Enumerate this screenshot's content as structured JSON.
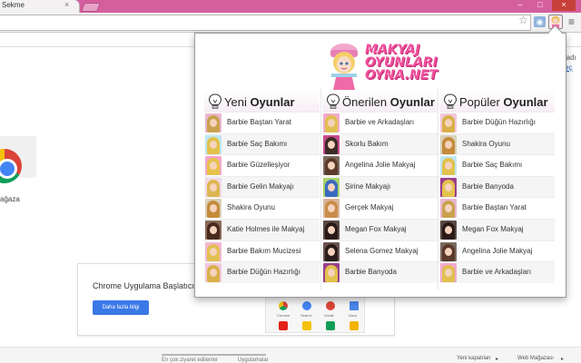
{
  "browser": {
    "tab_title": "Sekme",
    "tab_close": "×",
    "win_minimize": "–",
    "win_maximize": "□",
    "win_close": "×",
    "star_icon": "☆",
    "menu_icon": "≡",
    "camera_icon": "camera-icon"
  },
  "background_page": {
    "store_label": "ağaza",
    "right_text_1": "ınadı",
    "right_text_2": "eç",
    "launcher_title": "Chrome Uygulama Başlatıcıy",
    "launcher_button": "Daha fazla bilgi",
    "mini_apps": [
      "Chrome",
      "Search",
      "Gmail",
      "Docs"
    ],
    "bottom_tabs": [
      "En çok ziyaret edilenler",
      "Uygulamalar"
    ],
    "bottom_right": [
      "Yeni kapatılan",
      "Web Mağazası"
    ],
    "bottom_right_arrow": "▸"
  },
  "popup": {
    "logo_lines": [
      "MAKYAJ",
      "OYUNLARI",
      "OYNA.NET"
    ],
    "columns": [
      {
        "title_light": "Yeni ",
        "title_bold": "Oyunlar",
        "items": [
          {
            "label": "Barbie Baştan Yarat",
            "hair": "#c9a24e",
            "bg": "#e9b6cf"
          },
          {
            "label": "Barbie Saç Bakımı",
            "hair": "#e2c14b",
            "bg": "#bfe6f2"
          },
          {
            "label": "Barbie Güzelleşiyor",
            "hair": "#e6c24a",
            "bg": "#f4a6c9"
          },
          {
            "label": "Barbie Gelin Makyajı",
            "hair": "#dcb651",
            "bg": "#f0d8e6"
          },
          {
            "label": "Shakira Oyunu",
            "hair": "#c58b3b",
            "bg": "#d9d0b8"
          },
          {
            "label": "Katie Holmes ile Makyaj",
            "hair": "#4a2a1e",
            "bg": "#8a6a58"
          },
          {
            "label": "Barbie Bakım Mucizesi",
            "hair": "#e1c052",
            "bg": "#f2b7d3"
          },
          {
            "label": "Barbie Düğün Hazırlığı",
            "hair": "#d9b049",
            "bg": "#f3c7dd"
          }
        ]
      },
      {
        "title_light": "Önerilen ",
        "title_bold": "Oyunlar",
        "items": [
          {
            "label": "Barbie ve Arkadaşları",
            "hair": "#e0c04f",
            "bg": "#f2a9cd"
          },
          {
            "label": "Skorlu Bakım",
            "hair": "#3b2a25",
            "bg": "#c84a8e"
          },
          {
            "label": "Angelina Jolie Makyaj",
            "hair": "#5a3a2a",
            "bg": "#7a6a60"
          },
          {
            "label": "Şirine Makyajı",
            "hair": "#3a6ac0",
            "bg": "#a9d36a"
          },
          {
            "label": "Gerçek Makyaj",
            "hair": "#c98d4a",
            "bg": "#dbb49a"
          },
          {
            "label": "Megan Fox Makyaj",
            "hair": "#2a1a18",
            "bg": "#5a4a44"
          },
          {
            "label": "Selena Gomez Makyaj",
            "hair": "#2a1c1a",
            "bg": "#6a5450"
          },
          {
            "label": "Barbie Banyoda",
            "hair": "#e3c24c",
            "bg": "#9a3f8c"
          }
        ]
      },
      {
        "title_light": "Popüler ",
        "title_bold": "Oyunlar",
        "items": [
          {
            "label": "Barbie Düğün Hazırlığı",
            "hair": "#d9b049",
            "bg": "#f3c7dd"
          },
          {
            "label": "Shakira Oyunu",
            "hair": "#c58b3b",
            "bg": "#d9d0b8"
          },
          {
            "label": "Barbie Saç Bakımı",
            "hair": "#e2c14b",
            "bg": "#bfe6f2"
          },
          {
            "label": "Barbie Banyoda",
            "hair": "#e3c24c",
            "bg": "#9a3f8c"
          },
          {
            "label": "Barbie Baştan Yarat",
            "hair": "#c9a24e",
            "bg": "#e9b6cf"
          },
          {
            "label": "Megan Fox Makyaj",
            "hair": "#2a1a18",
            "bg": "#5a4a44"
          },
          {
            "label": "Angelina Jolie Makyaj",
            "hair": "#5a3a2a",
            "bg": "#7a6a60"
          },
          {
            "label": "Barbie ve Arkadaşları",
            "hair": "#e0c04f",
            "bg": "#f2a9cd"
          }
        ]
      }
    ]
  },
  "colors": {
    "titlebar": "#d55f9d",
    "logo_pink": "#f0509c",
    "launcher_button": "#3b78e7"
  }
}
